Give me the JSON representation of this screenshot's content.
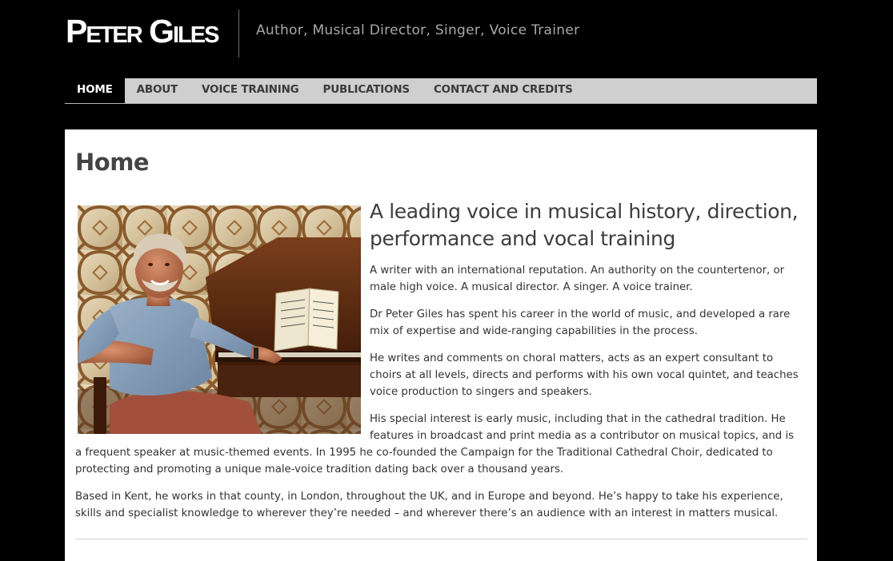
{
  "site": {
    "name": "Peter Giles",
    "tagline": "Author, Musical Director, Singer, Voice Trainer"
  },
  "nav": {
    "items": [
      {
        "label": "HOME",
        "active": true
      },
      {
        "label": "ABOUT"
      },
      {
        "label": "VOICE TRAINING"
      },
      {
        "label": "PUBLICATIONS"
      },
      {
        "label": "CONTACT AND CREDITS"
      }
    ]
  },
  "page": {
    "title": "Home",
    "lead": "A leading voice in musical history, direction, performance and vocal training",
    "paragraphs": [
      "A writer with an international reputation. An authority on the countertenor, or male high voice. A musical director. A singer. A voice trainer.",
      "Dr Peter Giles has spent his career in the world of music, and developed a rare mix of expertise and wide-ranging capabilities in the process.",
      "He writes and comments on choral matters, acts as an expert consultant to choirs at all levels, directs and performs with his own vocal quintet, and teaches voice production to singers and speakers.",
      "His special interest is early music, including that in the cathedral tradition. He features in broadcast and print media as a contributor on musical topics, and is a frequent  speaker at music-themed events.  In 1995 he co-founded the Campaign for the Traditional Cathedral Choir, dedicated to protecting and promoting a unique male-voice tradition dating back over a thousand years.",
      "Based in Kent, he works in that county, in London, throughout the UK, and in Europe and beyond. He’s happy to take his experience, skills and specialist knowledge to wherever they’re needed – and wherever there’s an audience with an interest in matters musical."
    ]
  },
  "colors": {
    "background": "#000000",
    "nav_bar": "#cfcfcf",
    "nav_active": "#000000",
    "content_bg": "#ffffff",
    "text": "#333333",
    "tagline": "#a8a8a8"
  }
}
